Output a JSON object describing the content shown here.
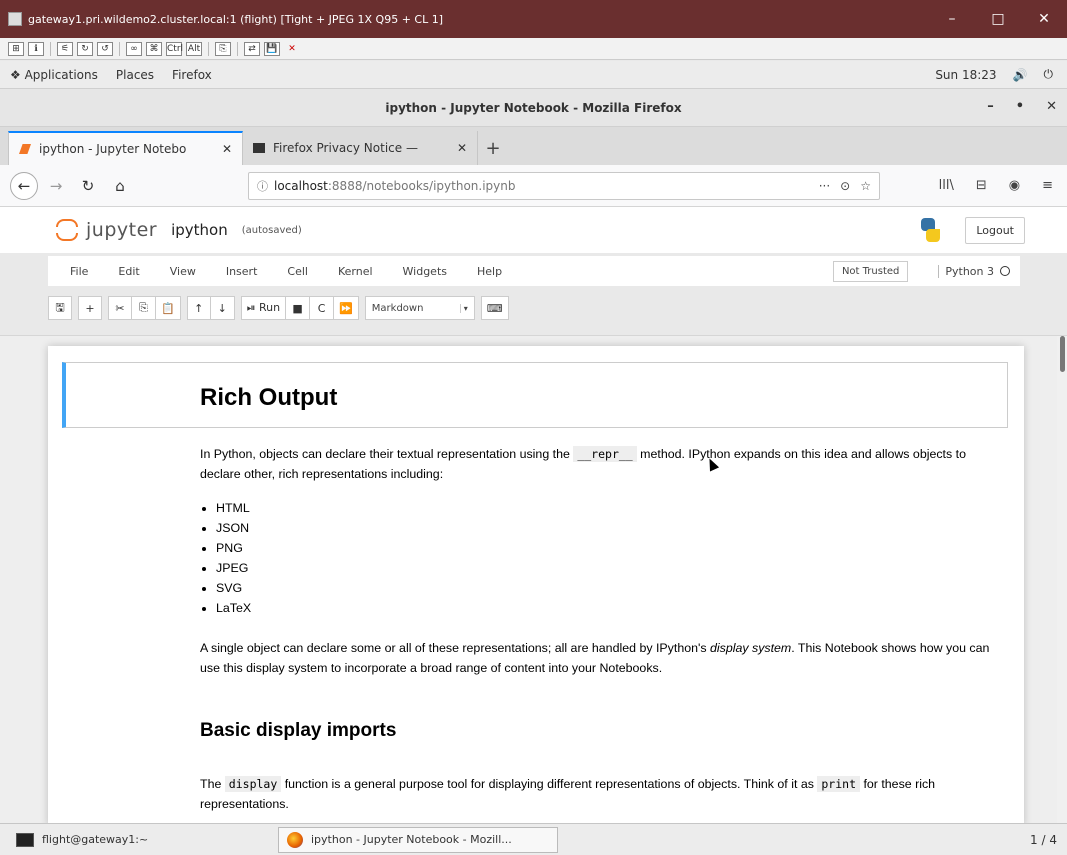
{
  "vnc": {
    "title": "gateway1.pri.wildemo2.cluster.local:1 (flight) [Tight + JPEG 1X Q95 + CL 1]",
    "tools": [
      "⊞",
      "ℹ",
      "⚟",
      "↻",
      "↺",
      "∞",
      "⌘",
      "Ctrl",
      "Alt",
      "⎘",
      "⇄",
      "💾",
      "✕"
    ],
    "controls": [
      "–",
      "□",
      "✕"
    ]
  },
  "gnome": {
    "menus": [
      "Applications",
      "Places",
      "Firefox"
    ],
    "clock": "Sun 18:23",
    "volume_icon": "🔊",
    "power_icon": "⏻"
  },
  "firefox": {
    "window_title": "ipython - Jupyter Notebook - Mozilla Firefox",
    "window_controls": [
      "–",
      "•",
      "✕"
    ],
    "tabs": [
      {
        "title": "ipython - Jupyter Notebo",
        "close": "✕"
      },
      {
        "title": "Firefox Privacy Notice — ",
        "close": "✕"
      }
    ],
    "new_tab": "+",
    "url_info": "ⓘ",
    "url_host": "localhost",
    "url_path": ":8888/notebooks/ipython.ipynb",
    "url_actions": [
      "···",
      "⊙",
      "☆"
    ],
    "nav_right": [
      "lll\\",
      "⊟",
      "◉",
      "≡"
    ],
    "back": "←",
    "forward": "→",
    "reload": "↻",
    "home": "⌂"
  },
  "jupyter": {
    "brand": "jupyter",
    "notebook_name": "ipython",
    "autosave": "(autosaved)",
    "logout": "Logout",
    "menu": [
      "File",
      "Edit",
      "View",
      "Insert",
      "Cell",
      "Kernel",
      "Widgets",
      "Help"
    ],
    "trust": "Not Trusted",
    "kernel": "Python 3",
    "toolbar": {
      "save": "🖫",
      "add": "+",
      "cut": "✂",
      "copy": "⎘",
      "paste": "📋",
      "up": "↑",
      "down": "↓",
      "run": "⏯ Run",
      "stop": "■",
      "restart": "C",
      "restart_run": "⏩",
      "cell_type": "Markdown",
      "caret": "▾",
      "keyboard": "⌨"
    }
  },
  "notebook": {
    "h1": "Rich Output",
    "p1_a": "In Python, objects can declare their textual representation using the ",
    "p1_code": "__repr__",
    "p1_b": " method. IPython expands on this idea and allows objects to declare other, rich representations including:",
    "list": [
      "HTML",
      "JSON",
      "PNG",
      "JPEG",
      "SVG",
      "LaTeX"
    ],
    "p2_a": "A single object can declare some or all of these representations; all are handled by IPython's ",
    "p2_em": "display system",
    "p2_b": ". This Notebook shows how you can use this display system to incorporate a broad range of content into your Notebooks.",
    "h2": "Basic display imports",
    "p3_a": "The ",
    "p3_code1": "display",
    "p3_b": " function is a general purpose tool for displaying different representations of objects. Think of it as ",
    "p3_code2": "print",
    "p3_c": " for these rich representations."
  },
  "taskbar": {
    "terminal": "flight@gateway1:~",
    "firefox": "ipython - Jupyter Notebook - Mozill...",
    "workspace": "1 / 4"
  }
}
